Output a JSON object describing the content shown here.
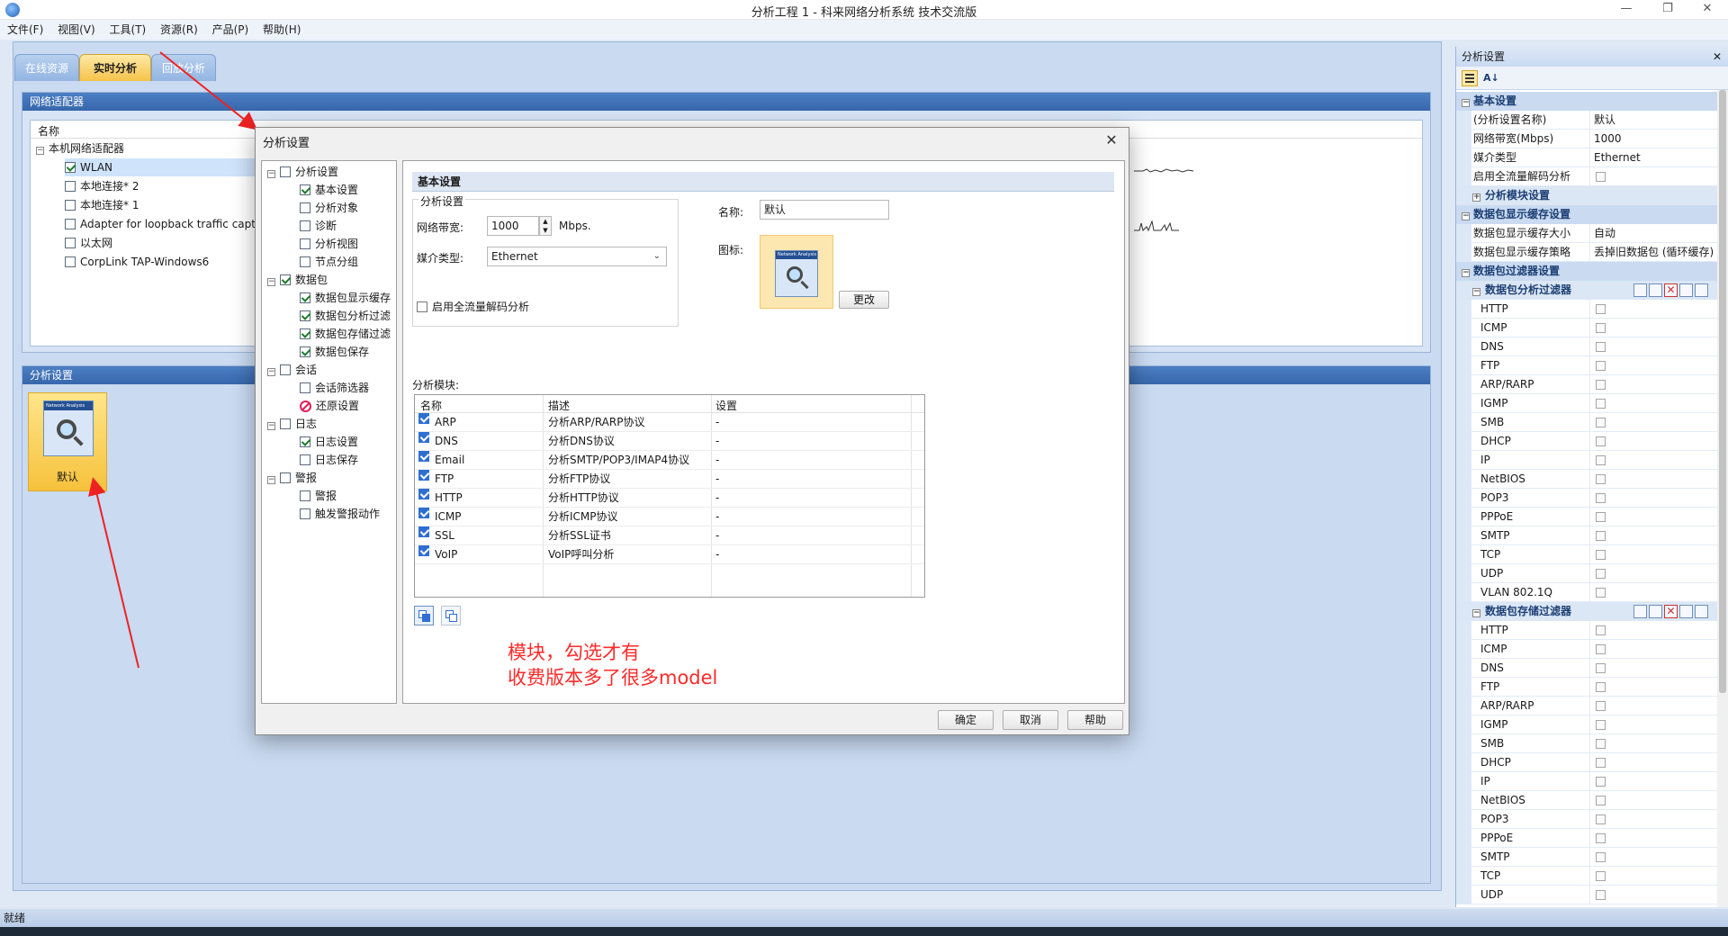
{
  "window": {
    "title": "分析工程 1 - 科来网络分析系统 技术交流版",
    "controls": [
      "—",
      "❐",
      "✕"
    ]
  },
  "menu": [
    "文件(F)",
    "视图(V)",
    "工具(T)",
    "资源(R)",
    "产品(P)",
    "帮助(H)"
  ],
  "tabs": [
    "在线资源",
    "实时分析",
    "回放分析"
  ],
  "adapters_panel": {
    "title": "网络适配器",
    "column": "名称",
    "root": "本机网络适配器",
    "items": [
      {
        "label": "WLAN",
        "checked": true
      },
      {
        "label": "本地连接* 2",
        "checked": false
      },
      {
        "label": "本地连接* 1",
        "checked": false
      },
      {
        "label": "Adapter for loopback traffic capt",
        "checked": false
      },
      {
        "label": "以太网",
        "checked": false
      },
      {
        "label": "CorpLink TAP-Windows6",
        "checked": false
      }
    ]
  },
  "analysis_panel": {
    "title": "分析设置",
    "profile_label": "默认",
    "icon_caption": "Network Analysis"
  },
  "dialog": {
    "title": "分析设置",
    "close": "✕",
    "tree": [
      {
        "label": "分析设置",
        "level": 0,
        "checked": false,
        "expander": "−"
      },
      {
        "label": "基本设置",
        "level": 1,
        "checked": true
      },
      {
        "label": "分析对象",
        "level": 1,
        "checked": false
      },
      {
        "label": "诊断",
        "level": 1,
        "checked": false
      },
      {
        "label": "分析视图",
        "level": 1,
        "checked": false
      },
      {
        "label": "节点分组",
        "level": 1,
        "checked": false
      },
      {
        "label": "数据包",
        "level": 0,
        "checked": true,
        "expander": "−"
      },
      {
        "label": "数据包显示缓存",
        "level": 1,
        "checked": true
      },
      {
        "label": "数据包分析过滤",
        "level": 1,
        "checked": true
      },
      {
        "label": "数据包存储过滤",
        "level": 1,
        "checked": true
      },
      {
        "label": "数据包保存",
        "level": 1,
        "checked": true
      },
      {
        "label": "会话",
        "level": 0,
        "checked": false,
        "expander": "−"
      },
      {
        "label": "会话筛选器",
        "level": 1,
        "checked": false
      },
      {
        "label": "还原设置",
        "level": 1,
        "checked": false,
        "blocked": true
      },
      {
        "label": "日志",
        "level": 0,
        "checked": false,
        "expander": "−"
      },
      {
        "label": "日志设置",
        "level": 1,
        "checked": true
      },
      {
        "label": "日志保存",
        "level": 1,
        "checked": false
      },
      {
        "label": "警报",
        "level": 0,
        "checked": false,
        "expander": "−"
      },
      {
        "label": "警报",
        "level": 1,
        "checked": false
      },
      {
        "label": "触发警报动作",
        "level": 1,
        "checked": false
      }
    ],
    "section_title": "基本设置",
    "group_title": "分析设置",
    "bandwidth_label": "网络带宽:",
    "bandwidth_value": "1000",
    "bandwidth_unit": "Mbps.",
    "media_label": "媒介类型:",
    "media_value": "Ethernet",
    "full_decode_label": "启用全流量解码分析",
    "full_decode_checked": false,
    "name_label": "名称:",
    "name_value": "默认",
    "icon_label": "图标:",
    "icon_caption": "Network Analysis",
    "change_button": "更改",
    "modules_label": "分析模块:",
    "modules_columns": [
      "名称",
      "描述",
      "设置"
    ],
    "modules": [
      {
        "name": "ARP",
        "desc": "分析ARP/RARP协议",
        "setting": "-",
        "checked": true
      },
      {
        "name": "DNS",
        "desc": "分析DNS协议",
        "setting": "-",
        "checked": true
      },
      {
        "name": "Email",
        "desc": "分析SMTP/POP3/IMAP4协议",
        "setting": "-",
        "checked": true
      },
      {
        "name": "FTP",
        "desc": "分析FTP协议",
        "setting": "-",
        "checked": true
      },
      {
        "name": "HTTP",
        "desc": "分析HTTP协议",
        "setting": "-",
        "checked": true
      },
      {
        "name": "ICMP",
        "desc": "分析ICMP协议",
        "setting": "-",
        "checked": true
      },
      {
        "name": "SSL",
        "desc": "分析SSL证书",
        "setting": "-",
        "checked": true
      },
      {
        "name": "VoIP",
        "desc": "VoIP呼叫分析",
        "setting": "-",
        "checked": true
      }
    ],
    "buttons": {
      "ok": "确定",
      "cancel": "取消",
      "help": "帮助"
    }
  },
  "annotation": {
    "line1": "模块，勾选才有",
    "line2": "收费版本多了很多model",
    "color": "#ff2a2a"
  },
  "property_panel": {
    "title": "分析设置",
    "close": "✕",
    "categories": {
      "basic": "基本设置",
      "display_cache": "数据包显示缓存设置",
      "filters": "数据包过滤器设置",
      "analysis_filter": "数据包分析过滤器",
      "storage_filter": "数据包存储过滤器",
      "modules": "分析模块设置"
    },
    "basic_rows": [
      {
        "key": "(分析设置名称)",
        "value": "默认"
      },
      {
        "key": "网络带宽(Mbps)",
        "value": "1000"
      },
      {
        "key": "媒介类型",
        "value": "Ethernet"
      },
      {
        "key": "启用全流量解码分析",
        "value": ""
      }
    ],
    "cache_rows": [
      {
        "key": "数据包显示缓存大小",
        "value": "自动"
      },
      {
        "key": "数据包显示缓存策略",
        "value": "丢掉旧数据包 (循环缓存)"
      }
    ],
    "analysis_filters": [
      "HTTP",
      "ICMP",
      "DNS",
      "FTP",
      "ARP/RARP",
      "IGMP",
      "SMB",
      "DHCP",
      "IP",
      "NetBIOS",
      "POP3",
      "PPPoE",
      "SMTP",
      "TCP",
      "UDP",
      "VLAN 802.1Q"
    ],
    "storage_filters": [
      "HTTP",
      "ICMP",
      "DNS",
      "FTP",
      "ARP/RARP",
      "IGMP",
      "SMB",
      "DHCP",
      "IP",
      "NetBIOS",
      "POP3",
      "PPPoE",
      "SMTP",
      "TCP",
      "UDP"
    ]
  },
  "status": "就绪"
}
